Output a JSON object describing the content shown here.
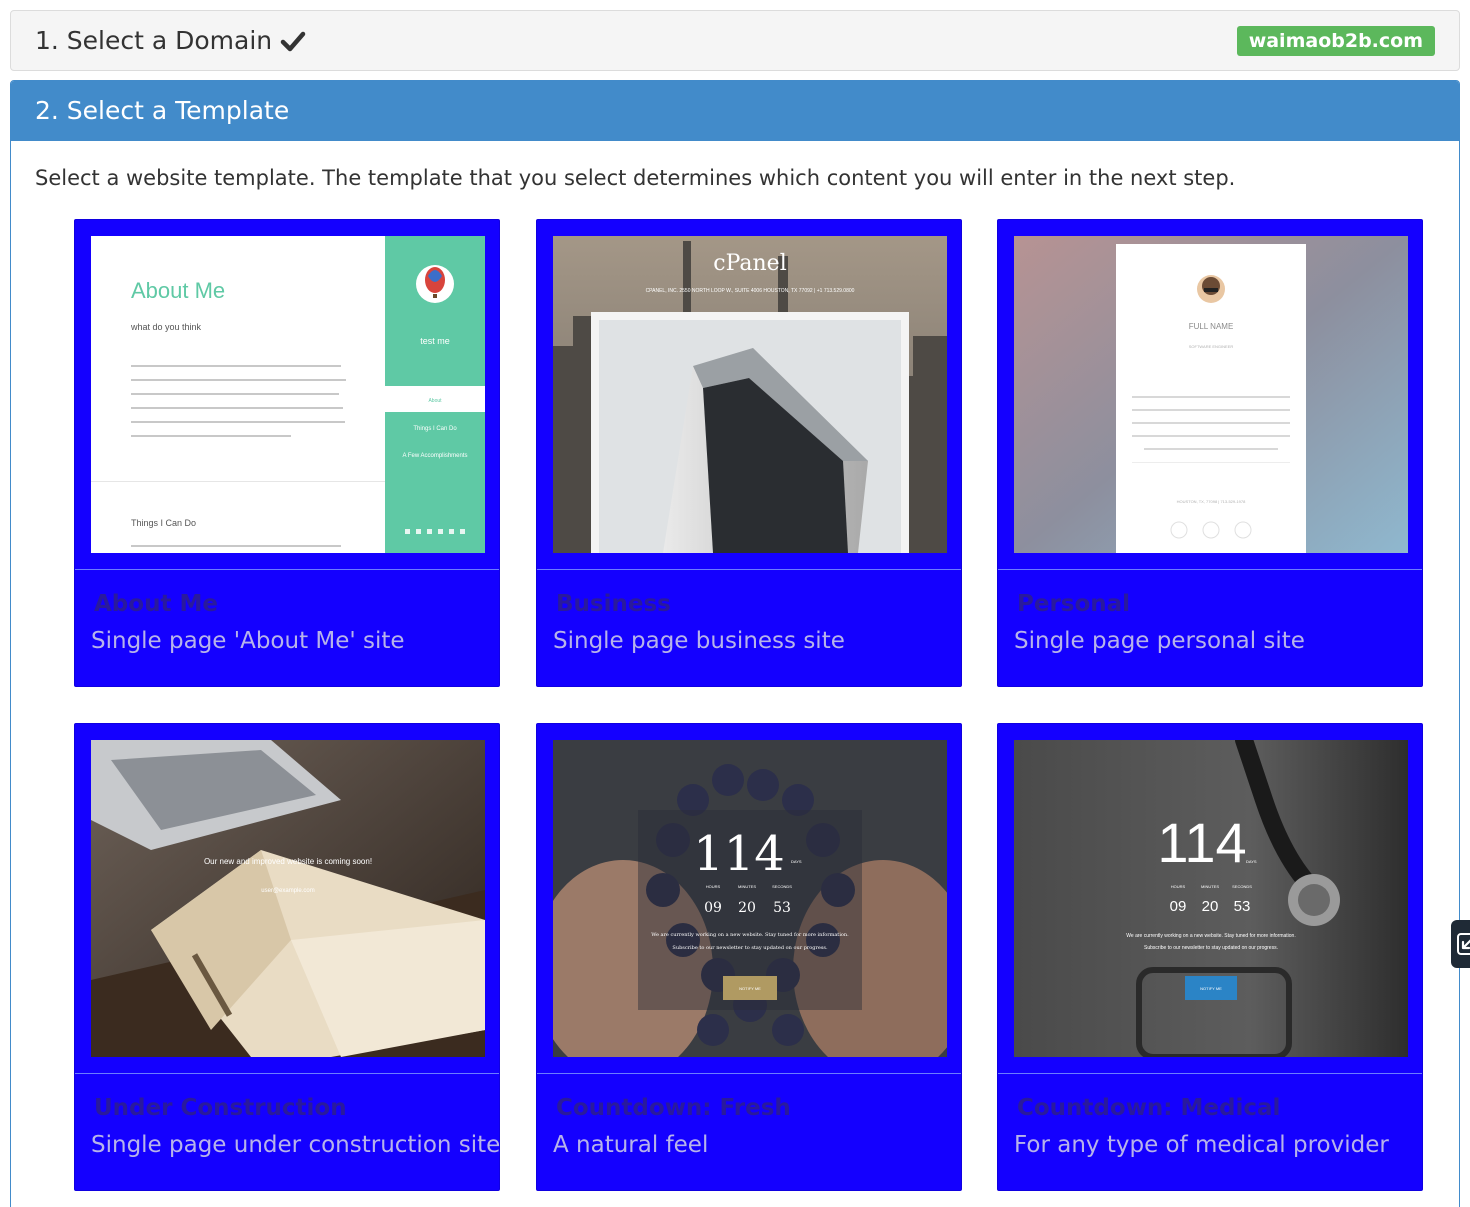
{
  "step1": {
    "title": "1. Select a Domain",
    "badge": "waimaob2b.com"
  },
  "step2": {
    "title": "2. Select a Template",
    "intro": "Select a website template. The template that you select determines which content you will enter in the next step."
  },
  "colors": {
    "accent_blue": "#428bca",
    "badge_green": "#5cb85c",
    "card_blue": "#1400ff"
  },
  "templates": [
    {
      "name": "About Me",
      "description": "Single page 'About Me' site",
      "preview": {
        "heading": "About Me",
        "subheading": "what do you think",
        "section": "Things I Can Do",
        "side_name": "test me",
        "side_links": [
          "About",
          "Things I Can Do",
          "A Few Accomplishments"
        ]
      }
    },
    {
      "name": "Business",
      "description": "Single page business site",
      "preview": {
        "brand": "cPanel",
        "address": "CPANEL, INC. 2550 NORTH LOOP W., SUITE 4006 HOUSTON, TX 77092 | +1 713.529.0800"
      }
    },
    {
      "name": "Personal",
      "description": "Single page personal site",
      "preview": {
        "full_name": "FULL NAME",
        "job_title": "SOFTWARE ENGINEER",
        "location": "HOUSTON, TX, 77098 | 713-529-1978"
      }
    },
    {
      "name": "Under Construction",
      "description": "Single page under construction site",
      "preview": {
        "message": "Our new and improved website is coming soon!",
        "email": "user@example.com"
      }
    },
    {
      "name": "Countdown: Fresh",
      "description": "A natural feel",
      "preview": {
        "days": "114",
        "days_label": "DAYS",
        "hours": "09",
        "minutes": "20",
        "seconds": "53",
        "hours_label": "HOURS",
        "minutes_label": "MINUTES",
        "seconds_label": "SECONDS",
        "line1": "We are currently working on a new website. Stay tuned for more information.",
        "line2": "Subscribe to our newsletter to stay updated on our progress.",
        "button": "NOTIFY ME"
      }
    },
    {
      "name": "Countdown: Medical",
      "description": "For any type of medical provider",
      "preview": {
        "days": "114",
        "days_label": "DAYS",
        "hours": "09",
        "minutes": "20",
        "seconds": "53",
        "hours_label": "HOURS",
        "minutes_label": "MINUTES",
        "seconds_label": "SECONDS",
        "line1": "We are currently working on a new website. Stay tuned for more information.",
        "line2": "Subscribe to our newsletter to stay updated on our progress.",
        "button": "NOTIFY ME"
      }
    }
  ]
}
